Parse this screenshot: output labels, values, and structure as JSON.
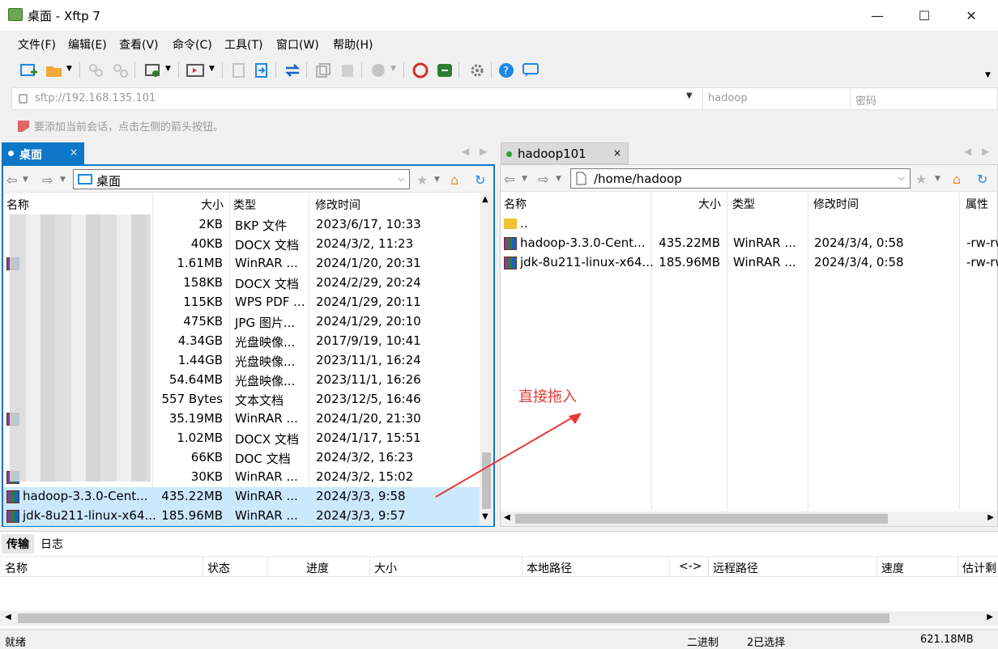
{
  "window": {
    "title": "桌面 - Xftp 7",
    "min": "—",
    "max": "☐",
    "close": "✕"
  },
  "menu": [
    "文件(F)",
    "编辑(E)",
    "查看(V)",
    "命令(C)",
    "工具(T)",
    "窗口(W)",
    "帮助(H)"
  ],
  "address": {
    "url": "sftp://192.168.135.101",
    "user_placeholder": "hadoop",
    "password_placeholder": "密码"
  },
  "hint": "要添加当前会话，点击左侧的箭头按钮。",
  "left_tab": {
    "label": "桌面",
    "close": "×"
  },
  "right_tab": {
    "label": "hadoop101",
    "close": "×"
  },
  "left_pane": {
    "path": "桌面",
    "columns": {
      "name": "名称",
      "size": "大小",
      "type": "类型",
      "modified": "修改时间"
    },
    "rows": [
      {
        "name": "",
        "size": "2KB",
        "type": "BKP 文件",
        "modified": "2023/6/17, 10:33"
      },
      {
        "name": "",
        "size": "40KB",
        "type": "DOCX 文档",
        "modified": "2024/3/2, 11:23"
      },
      {
        "name": "",
        "size": "1.61MB",
        "type": "WinRAR ...",
        "modified": "2024/1/20, 20:31"
      },
      {
        "name": "",
        "size": "158KB",
        "type": "DOCX 文档",
        "modified": "2024/2/29, 20:24"
      },
      {
        "name": "",
        "size": "115KB",
        "type": "WPS PDF ...",
        "modified": "2024/1/29, 20:11"
      },
      {
        "name": "",
        "size": "475KB",
        "type": "JPG 图片...",
        "modified": "2024/1/29, 20:10"
      },
      {
        "name": "",
        "size": "4.34GB",
        "type": "光盘映像...",
        "modified": "2017/9/19, 10:41"
      },
      {
        "name": "",
        "size": "1.44GB",
        "type": "光盘映像...",
        "modified": "2023/11/1, 16:24"
      },
      {
        "name": "",
        "size": "54.64MB",
        "type": "光盘映像...",
        "modified": "2023/11/1, 16:26"
      },
      {
        "name": "",
        "size": "557 Bytes",
        "type": "文本文档",
        "modified": "2023/12/5, 16:46"
      },
      {
        "name": "",
        "size": "35.19MB",
        "type": "WinRAR ...",
        "modified": "2024/1/20, 21:30"
      },
      {
        "name": "",
        "size": "1.02MB",
        "type": "DOCX 文档",
        "modified": "2024/1/17, 15:51"
      },
      {
        "name": "",
        "size": "66KB",
        "type": "DOC 文档",
        "modified": "2024/3/2, 16:23"
      },
      {
        "name": "",
        "size": "30KB",
        "type": "WinRAR ...",
        "modified": "2024/3/2, 15:02"
      },
      {
        "name": "hadoop-3.3.0-Cent...",
        "size": "435.22MB",
        "type": "WinRAR ...",
        "modified": "2024/3/3, 9:58"
      },
      {
        "name": "jdk-8u211-linux-x64...",
        "size": "185.96MB",
        "type": "WinRAR ...",
        "modified": "2024/3/3, 9:57"
      }
    ]
  },
  "right_pane": {
    "path": "/home/hadoop",
    "columns": {
      "name": "名称",
      "size": "大小",
      "type": "类型",
      "modified": "修改时间",
      "attr": "属性"
    },
    "rows": [
      {
        "name": "..",
        "size": "",
        "type": "",
        "modified": "",
        "attr": ""
      },
      {
        "name": "hadoop-3.3.0-Cent...",
        "size": "435.22MB",
        "type": "WinRAR ...",
        "modified": "2024/3/4, 0:58",
        "attr": "-rw-rw"
      },
      {
        "name": "jdk-8u211-linux-x64...",
        "size": "185.96MB",
        "type": "WinRAR ...",
        "modified": "2024/3/4, 0:58",
        "attr": "-rw-rw"
      }
    ]
  },
  "annotation": "直接拖入",
  "transfer": {
    "tabs": [
      "传输",
      "日志"
    ],
    "columns": [
      "名称",
      "状态",
      "进度",
      "大小",
      "本地路径",
      "<->",
      "远程路径",
      "速度",
      "估计剩"
    ]
  },
  "status": {
    "ready": "就绪",
    "mode": "二进制",
    "selected": "2已选择",
    "total": "621.18MB"
  }
}
